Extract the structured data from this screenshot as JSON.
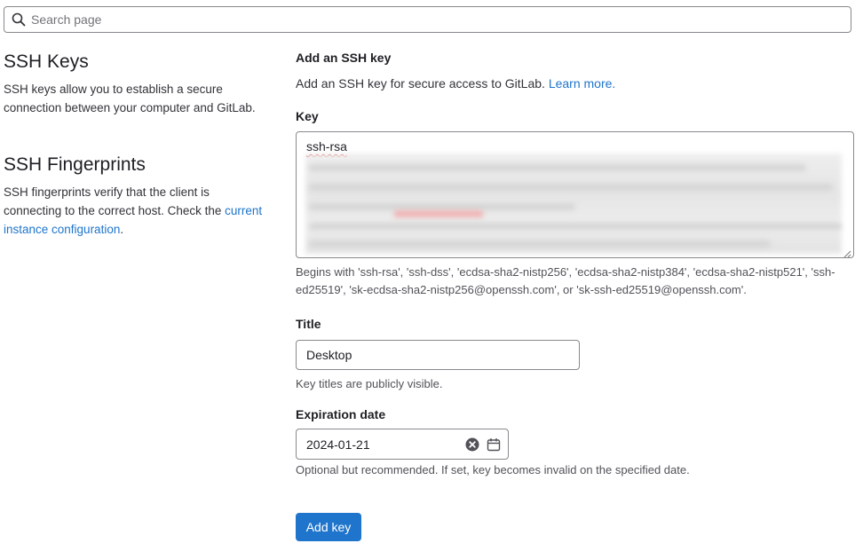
{
  "search": {
    "placeholder": "Search page"
  },
  "left": {
    "ssh_keys": {
      "title": "SSH Keys",
      "description": "SSH keys allow you to establish a secure connection between your computer and GitLab."
    },
    "ssh_fingerprints": {
      "title": "SSH Fingerprints",
      "description_prefix": "SSH fingerprints verify that the client is connecting to the correct host. Check the ",
      "link_text": "current instance configuration",
      "description_suffix": "."
    }
  },
  "form": {
    "heading": "Add an SSH key",
    "description": "Add an SSH key for secure access to GitLab.",
    "learn_more": "Learn more.",
    "key": {
      "label": "Key",
      "value_prefix": "ssh-rsa",
      "hint": "Begins with 'ssh-rsa', 'ssh-dss', 'ecdsa-sha2-nistp256', 'ecdsa-sha2-nistp384', 'ecdsa-sha2-nistp521', 'ssh-ed25519', 'sk-ecdsa-sha2-nistp256@openssh.com', or 'sk-ssh-ed25519@openssh.com'."
    },
    "title": {
      "label": "Title",
      "value": "Desktop",
      "hint": "Key titles are publicly visible."
    },
    "expiration": {
      "label": "Expiration date",
      "value": "2024-01-21",
      "hint": "Optional but recommended. If set, key becomes invalid on the specified date."
    },
    "submit_label": "Add key"
  },
  "colors": {
    "accent": "#1f75cb",
    "border": "#89888d",
    "text": "#333238"
  },
  "icons": {
    "search": "search-icon",
    "clear": "clear-icon",
    "calendar": "calendar-icon"
  }
}
